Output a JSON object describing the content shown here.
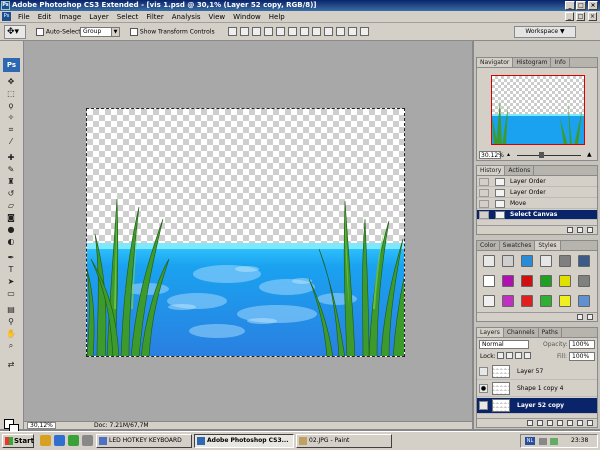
{
  "window": {
    "title": "Adobe Photoshop CS3 Extended - [vis 1.psd @ 30,1% (Layer 52 copy, RGB/8)]",
    "app_icon": "Ps"
  },
  "menu": [
    "File",
    "Edit",
    "Image",
    "Layer",
    "Select",
    "Filter",
    "Analysis",
    "View",
    "Window",
    "Help"
  ],
  "options": {
    "auto_select_label": "Auto-Select:",
    "auto_select_value": "Group",
    "show_transform_label": "Show Transform Controls",
    "workspace_label": "Workspace"
  },
  "tools": {
    "logo": "Ps",
    "icons": [
      "move-tool-icon",
      "marquee-tool-icon",
      "lasso-tool-icon",
      "magic-wand-icon",
      "crop-tool-icon",
      "slice-tool-icon",
      "healing-brush-icon",
      "brush-tool-icon",
      "clone-stamp-icon",
      "history-brush-icon",
      "eraser-icon",
      "paint-bucket-icon",
      "blur-tool-icon",
      "dodge-tool-icon",
      "pen-tool-icon",
      "type-tool-icon",
      "path-select-icon",
      "shape-tool-icon",
      "notes-tool-icon",
      "eyedropper-icon",
      "hand-tool-icon",
      "zoom-tool-icon"
    ]
  },
  "document": {
    "zoom": "30,12%",
    "doc_info": "Doc: 7.21M/67,7M"
  },
  "navigator": {
    "tabs": [
      "Navigator",
      "Histogram",
      "Info"
    ],
    "zoom": "30.12%"
  },
  "history": {
    "tabs": [
      "History",
      "Actions"
    ],
    "items": [
      {
        "label": "Layer Order",
        "selected": false
      },
      {
        "label": "Layer Order",
        "selected": false
      },
      {
        "label": "Move",
        "selected": false
      },
      {
        "label": "Select Canvas",
        "selected": true
      }
    ]
  },
  "styles": {
    "tabs": [
      "Color",
      "Swatches",
      "Styles"
    ],
    "swatch_colors": [
      "#e8e8e8",
      "#cfcfcf",
      "#2a8bd8",
      "#e6e6e6",
      "#7f7f7f",
      "#3c5a8a",
      "#ffffff",
      "#b010b0",
      "#d01010",
      "#20a020",
      "#e0e000",
      "#808080",
      "#f0f0f0",
      "#c030c0",
      "#e02020",
      "#30b030",
      "#f0f020",
      "#6090d0"
    ]
  },
  "layers": {
    "tabs": [
      "Layers",
      "Channels",
      "Paths"
    ],
    "blend_mode": "Normal",
    "opacity_label": "Opacity:",
    "opacity": "100%",
    "lock_label": "Lock:",
    "fill_label": "Fill:",
    "fill": "100%",
    "rows": [
      {
        "label": "Layer 57",
        "visible": false,
        "selected": false
      },
      {
        "label": "Shape 1 copy 4",
        "visible": true,
        "selected": false
      },
      {
        "label": "Layer 52 copy",
        "visible": false,
        "selected": true
      }
    ]
  },
  "taskbar": {
    "start_label": "Start",
    "tasks": [
      {
        "label": "LED HOTKEY KEYBOARD",
        "active": false
      },
      {
        "label": "Adobe Photoshop CS3...",
        "active": true
      },
      {
        "label": "02.JPG - Paint",
        "active": false
      }
    ],
    "language": "NL",
    "time": "23:38"
  }
}
